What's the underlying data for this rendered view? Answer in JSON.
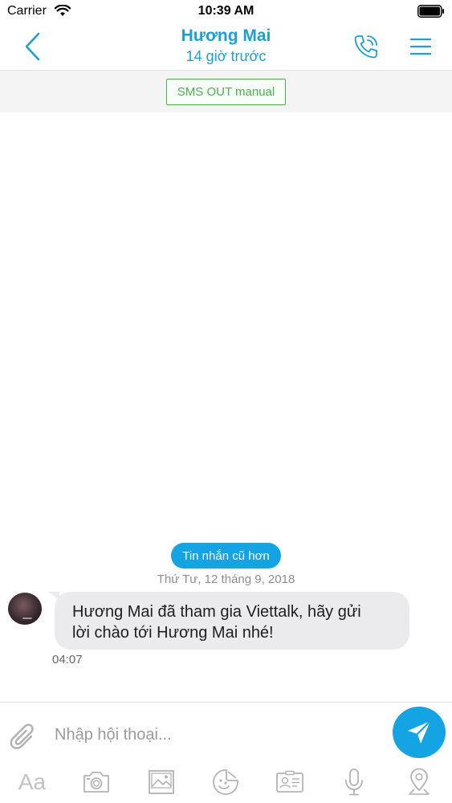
{
  "status_bar": {
    "carrier": "Carrier",
    "time": "10:39 AM"
  },
  "header": {
    "title": "Hương Mai",
    "subtitle": "14 giờ trước",
    "accent_color": "#1a9fd9"
  },
  "sms_mode": {
    "label": "SMS OUT manual",
    "color": "#4caf50"
  },
  "chat": {
    "older_messages_label": "Tin nhắn cũ hơn",
    "date_separator": "Thứ Tư, 12 tháng 9, 2018",
    "messages": [
      {
        "text_line1": "Hương Mai đã tham gia Viettalk, hãy gửi",
        "text_line2": "lời chào tới Hương Mai nhé!",
        "time": "04:07"
      }
    ]
  },
  "composer": {
    "placeholder": "Nhập hội thoại...",
    "text_tool_label": "Aa",
    "send_color": "#14a3e3"
  },
  "icons": [
    "back-chevron-icon",
    "phone-call-icon",
    "menu-icon",
    "paperclip-icon",
    "send-icon",
    "camera-icon",
    "image-icon",
    "sticker-icon",
    "contact-card-icon",
    "microphone-icon",
    "location-pin-icon"
  ]
}
